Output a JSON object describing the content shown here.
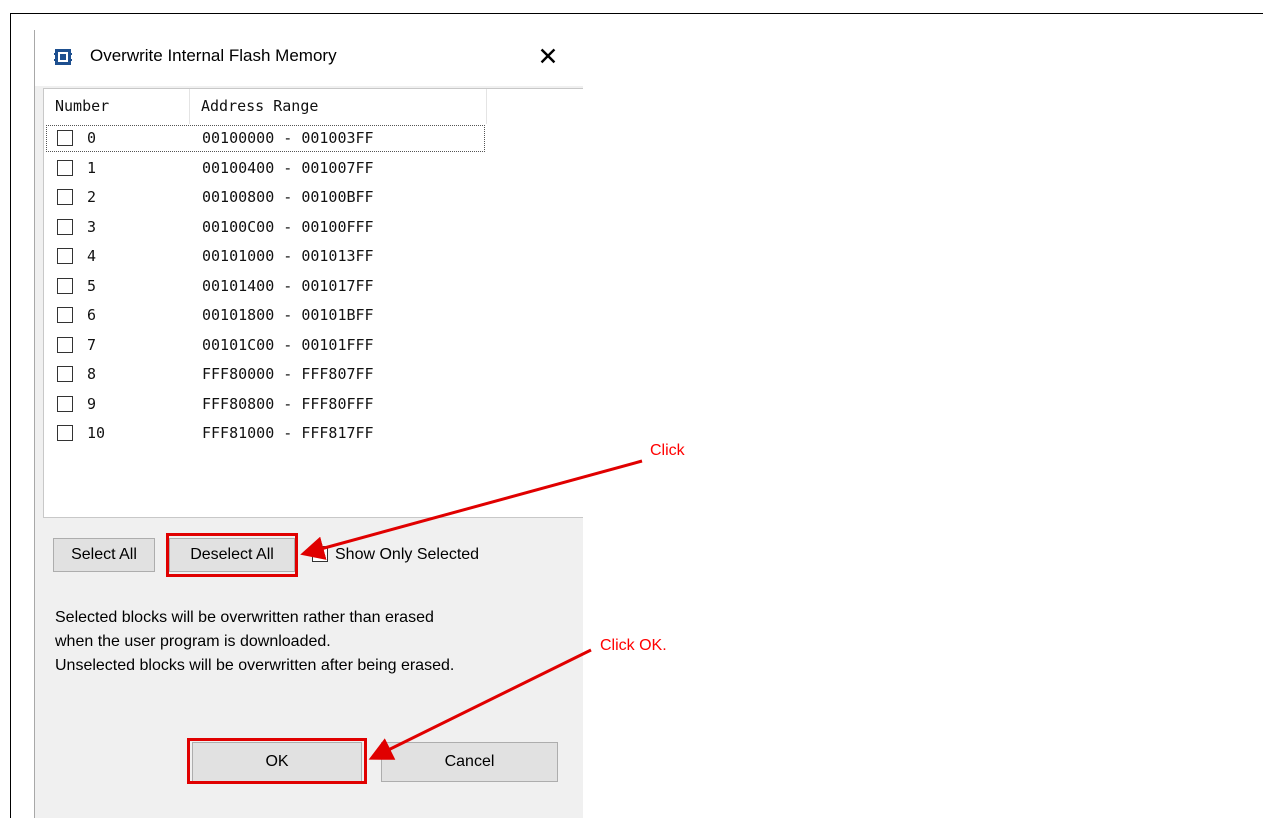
{
  "dialog": {
    "title": "Overwrite Internal Flash Memory",
    "close_glyph": "✕",
    "icon": "chip-icon"
  },
  "table": {
    "headers": {
      "number": "Number",
      "address": "Address Range"
    },
    "rows": [
      {
        "number": "0",
        "range": "00100000 - 001003FF"
      },
      {
        "number": "1",
        "range": "00100400 - 001007FF"
      },
      {
        "number": "2",
        "range": "00100800 - 00100BFF"
      },
      {
        "number": "3",
        "range": "00100C00 - 00100FFF"
      },
      {
        "number": "4",
        "range": "00101000 - 001013FF"
      },
      {
        "number": "5",
        "range": "00101400 - 001017FF"
      },
      {
        "number": "6",
        "range": "00101800 - 00101BFF"
      },
      {
        "number": "7",
        "range": "00101C00 - 00101FFF"
      },
      {
        "number": "8",
        "range": "FFF80000 - FFF807FF"
      },
      {
        "number": "9",
        "range": "FFF80800 - FFF80FFF"
      },
      {
        "number": "10",
        "range": "FFF81000 - FFF817FF"
      }
    ]
  },
  "buttons": {
    "select_all": "Select All",
    "deselect_all": "Deselect All",
    "ok": "OK",
    "cancel": "Cancel"
  },
  "show_only_selected": {
    "label": "Show Only Selected",
    "checked": false
  },
  "info_lines": [
    "Selected blocks will be overwritten rather than erased",
    "when the user program is downloaded.",
    "Unselected blocks will be overwritten after being erased."
  ],
  "annotations": {
    "click": "Click",
    "click_ok": "Click OK.",
    "color": "#ff0000"
  }
}
